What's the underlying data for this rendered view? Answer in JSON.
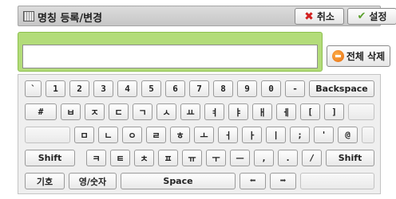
{
  "title": {
    "text": "명칭 등록/변경",
    "icon": "keyboard-icon"
  },
  "buttons": {
    "cancel": "취소",
    "settings": "설정",
    "clear_all": "전체 삭제"
  },
  "input": {
    "value": "",
    "placeholder": ""
  },
  "keyboard": {
    "row1": [
      "`",
      "1",
      "2",
      "3",
      "4",
      "5",
      "6",
      "7",
      "8",
      "9",
      "0",
      "-",
      "Backspace"
    ],
    "row2": [
      "#",
      "ㅂ",
      "ㅈ",
      "ㄷ",
      "ㄱ",
      "ㅅ",
      "ㅛ",
      "ㅕ",
      "ㅑ",
      "ㅐ",
      "ㅔ",
      "[",
      "]",
      ""
    ],
    "row3": [
      "",
      "ㅁ",
      "ㄴ",
      "ㅇ",
      "ㄹ",
      "ㅎ",
      "ㅗ",
      "ㅓ",
      "ㅏ",
      "ㅣ",
      ";",
      "'",
      "@",
      ""
    ],
    "row4": [
      "Shift",
      "ㅋ",
      "ㅌ",
      "ㅊ",
      "ㅍ",
      "ㅠ",
      "ㅜ",
      "ㅡ",
      ",",
      ".",
      "/",
      "Shift"
    ],
    "row5": {
      "symbols": "기호",
      "lang": "영/숫자",
      "space": "Space",
      "left_arrow_icon": "arrow-left-icon",
      "right_arrow_icon": "arrow-right-icon"
    }
  },
  "colors": {
    "input_frame": "#b3dc7a",
    "cancel_icon": "#d21f1f",
    "settings_icon": "#5aa02c"
  }
}
